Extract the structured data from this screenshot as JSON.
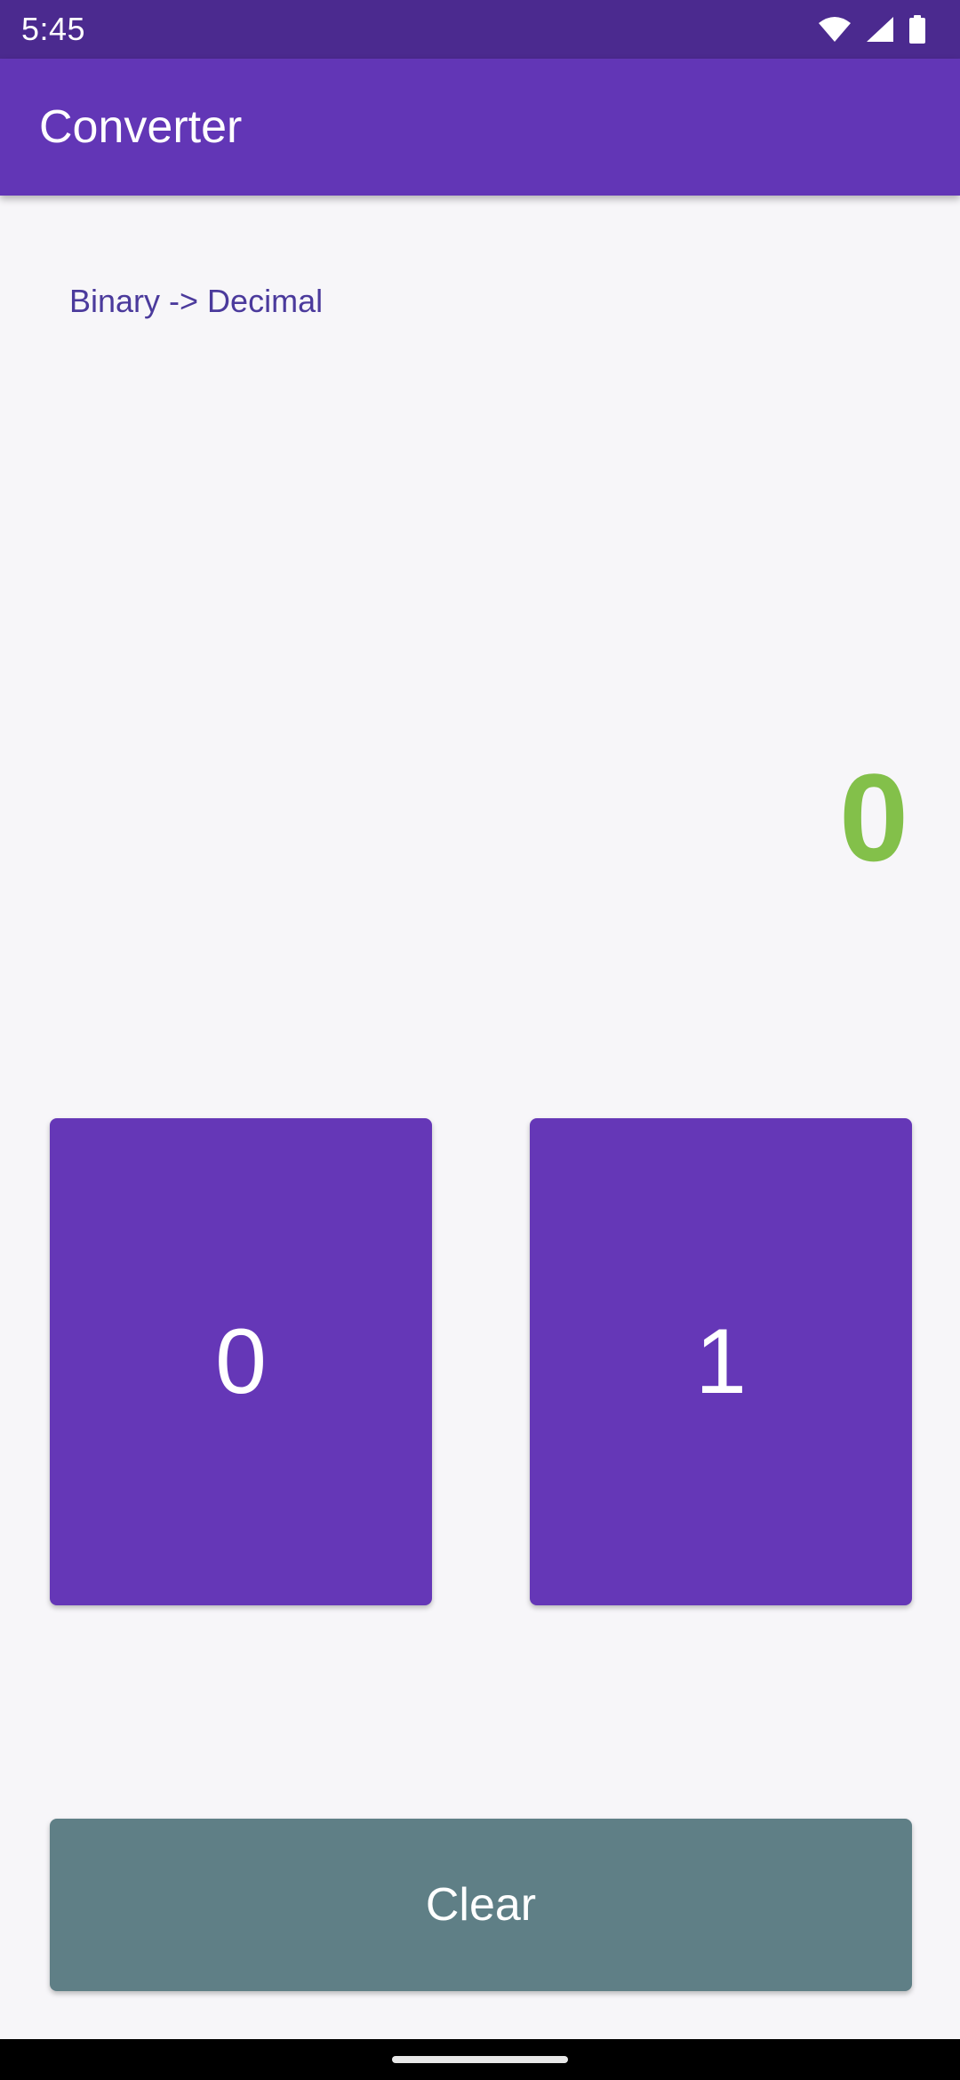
{
  "status_bar": {
    "time": "5:45",
    "icons": [
      "wifi-icon",
      "signal-icon",
      "battery-icon"
    ]
  },
  "app_bar": {
    "title": "Converter"
  },
  "main": {
    "mode_label": "Binary -> Decimal",
    "result": "0",
    "buttons": {
      "zero": "0",
      "one": "1",
      "clear": "Clear"
    }
  },
  "colors": {
    "status_bar": "#4b2a8f",
    "app_bar": "#6236b6",
    "primary_button": "#6537b7",
    "clear_button": "#5f7f86",
    "result_text": "#83c04a",
    "mode_label": "#4b3a9c",
    "background": "#f7f6f9"
  }
}
